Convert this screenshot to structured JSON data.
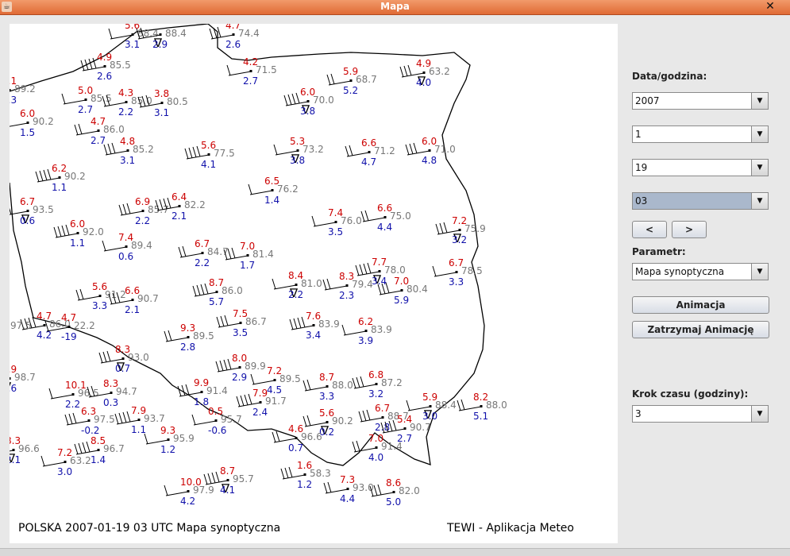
{
  "window": {
    "title": "Mapa",
    "close_glyph": "✕",
    "app_glyph": "☕"
  },
  "map": {
    "caption_left": "POLSKA 2007-01-19 03 UTC Mapa synoptyczna",
    "caption_right": "TEWI - Aplikacja Meteo",
    "stations": [
      {
        "t": "5.6",
        "h": "88.4",
        "p": "3.1"
      },
      {
        "t": "",
        "h": "88.4",
        "p": "2.9"
      },
      {
        "t": "4.7",
        "h": "74.4",
        "p": "2.6"
      },
      {
        "t": "4.9",
        "h": "85.5",
        "p": "2.6"
      },
      {
        "t": "4.2",
        "h": "71.5",
        "p": "2.7"
      },
      {
        "t": "5.9",
        "h": "68.7",
        "p": "5.2"
      },
      {
        "t": "4.9",
        "h": "63.2",
        "p": "4.0"
      },
      {
        "t": "6.1",
        "h": "89.2",
        "p": "2.3"
      },
      {
        "t": "5.0",
        "h": "85.5",
        "p": "2.7"
      },
      {
        "t": "4.3",
        "h": "85.0",
        "p": "2.2"
      },
      {
        "t": "3.8",
        "h": "80.5",
        "p": "3.1"
      },
      {
        "t": "6.0",
        "h": "70.0",
        "p": "3.8"
      },
      {
        "t": "6.0",
        "h": "90.2",
        "p": "1.5"
      },
      {
        "t": "4.7",
        "h": "86.0",
        "p": "2.7"
      },
      {
        "t": "4.8",
        "h": "85.2",
        "p": "3.1"
      },
      {
        "t": "5.6",
        "h": "77.5",
        "p": "4.1"
      },
      {
        "t": "5.3",
        "h": "73.2",
        "p": "3.8"
      },
      {
        "t": "6.6",
        "h": "71.2",
        "p": "4.7"
      },
      {
        "t": "6.0",
        "h": "71.0",
        "p": "4.8"
      },
      {
        "t": "6.2",
        "h": "90.2",
        "p": "1.1"
      },
      {
        "t": "6.5",
        "h": "76.2",
        "p": "1.4"
      },
      {
        "t": "6.7",
        "h": "93.5",
        "p": "0.6"
      },
      {
        "t": "6.9",
        "h": "85.7",
        "p": "2.2"
      },
      {
        "t": "6.4",
        "h": "82.2",
        "p": "2.1"
      },
      {
        "t": "7.4",
        "h": "76.0",
        "p": "3.5"
      },
      {
        "t": "6.6",
        "h": "75.0",
        "p": "4.4"
      },
      {
        "t": "7.2",
        "h": "75.9",
        "p": "3.2"
      },
      {
        "t": "6.0",
        "h": "92.0",
        "p": "1.1"
      },
      {
        "t": "7.4",
        "h": "89.4",
        "p": "0.6"
      },
      {
        "t": "6.7",
        "h": "84.7",
        "p": "2.2"
      },
      {
        "t": "7.0",
        "h": "81.4",
        "p": "1.7"
      },
      {
        "t": "7.7",
        "h": "78.0",
        "p": "3.4"
      },
      {
        "t": "6.7",
        "h": "78.5",
        "p": "3.3"
      },
      {
        "t": "5.6",
        "h": "91.2",
        "p": "3.3"
      },
      {
        "t": "6.6",
        "h": "90.7",
        "p": "2.1"
      },
      {
        "t": "8.7",
        "h": "86.0",
        "p": "5.7"
      },
      {
        "t": "8.4",
        "h": "81.0",
        "p": "2.2"
      },
      {
        "t": "8.3",
        "h": "79.4",
        "p": "2.3"
      },
      {
        "t": "7.0",
        "h": "80.4",
        "p": "5.9"
      },
      {
        "t": "4.7",
        "h": "86.0",
        "p": "4.2"
      },
      {
        "t": "4.7",
        "h": "22.2",
        "p": "-19"
      },
      {
        "t": "0",
        "h": "97.5",
        "p": "9"
      },
      {
        "t": "7.5",
        "h": "86.7",
        "p": "3.5"
      },
      {
        "t": "7.6",
        "h": "83.9",
        "p": "3.4"
      },
      {
        "t": "6.2",
        "h": "83.9",
        "p": "3.9"
      },
      {
        "t": "9.3",
        "h": "89.5",
        "p": "2.8"
      },
      {
        "t": "8.3",
        "h": "93.0",
        "p": "0.7"
      },
      {
        "t": "8.0",
        "h": "89.9",
        "p": "2.9"
      },
      {
        "t": "7.2",
        "h": "89.5",
        "p": "4.5"
      },
      {
        "t": "8.7",
        "h": "88.0",
        "p": "3.3"
      },
      {
        "t": "6.8",
        "h": "87.2",
        "p": "3.2"
      },
      {
        "t": "3.9",
        "h": "98.7",
        "p": "0.6"
      },
      {
        "t": "10.1",
        "h": "96.5",
        "p": "2.2"
      },
      {
        "t": "8.3",
        "h": "94.7",
        "p": "0.3"
      },
      {
        "t": "9.9",
        "h": "91.4",
        "p": "1.8"
      },
      {
        "t": "7.9",
        "h": "91.7",
        "p": "2.4"
      },
      {
        "t": "5.9",
        "h": "88.4",
        "p": "3.0"
      },
      {
        "t": "8.2",
        "h": "88.0",
        "p": "5.1"
      },
      {
        "t": "6.3",
        "h": "97.5",
        "p": "-0.2"
      },
      {
        "t": "7.9",
        "h": "93.7",
        "p": "1.1"
      },
      {
        "t": "0.5",
        "h": "95.7",
        "p": "-0.6"
      },
      {
        "t": "5.6",
        "h": "90.2",
        "p": "0.2"
      },
      {
        "t": "6.7",
        "h": "88.7",
        "p": "2.8"
      },
      {
        "t": "5.4",
        "h": "90.7",
        "p": "2.7"
      },
      {
        "t": "9.3",
        "h": "95.9",
        "p": "1.2"
      },
      {
        "t": "4.6",
        "h": "96.6",
        "p": "0.7"
      },
      {
        "t": "8.3",
        "h": "96.6",
        "p": "2.1"
      },
      {
        "t": "8.5",
        "h": "96.7",
        "p": "1.4"
      },
      {
        "t": "7.2",
        "h": "63.2",
        "p": "3.0"
      },
      {
        "t": "7.0",
        "h": "91.4",
        "p": "4.0"
      },
      {
        "t": "1.6",
        "h": "58.3",
        "p": "1.2"
      },
      {
        "t": "8.7",
        "h": "95.7",
        "p": "4.1"
      },
      {
        "t": "10.0",
        "h": "97.9",
        "p": "4.2"
      },
      {
        "t": "7.3",
        "h": "93.0",
        "p": "4.4"
      },
      {
        "t": "8.6",
        "h": "82.0",
        "p": "5.0"
      }
    ]
  },
  "controls": {
    "date_label": "Data/godzina:",
    "year": "2007",
    "month": "1",
    "day": "19",
    "hour": "03",
    "prev_label": "<",
    "next_label": ">",
    "param_label": "Parametr:",
    "param_value": "Mapa synoptyczna",
    "animate_label": "Animacja",
    "stop_label": "Zatrzymaj Animację",
    "step_label": "Krok czasu (godziny):",
    "step_value": "3",
    "arrow_glyph": "▼"
  },
  "colors": {
    "temp": "#cc0000",
    "humidity": "#777777",
    "pressure": "#1010aa",
    "title_bar": "#e87a45"
  }
}
